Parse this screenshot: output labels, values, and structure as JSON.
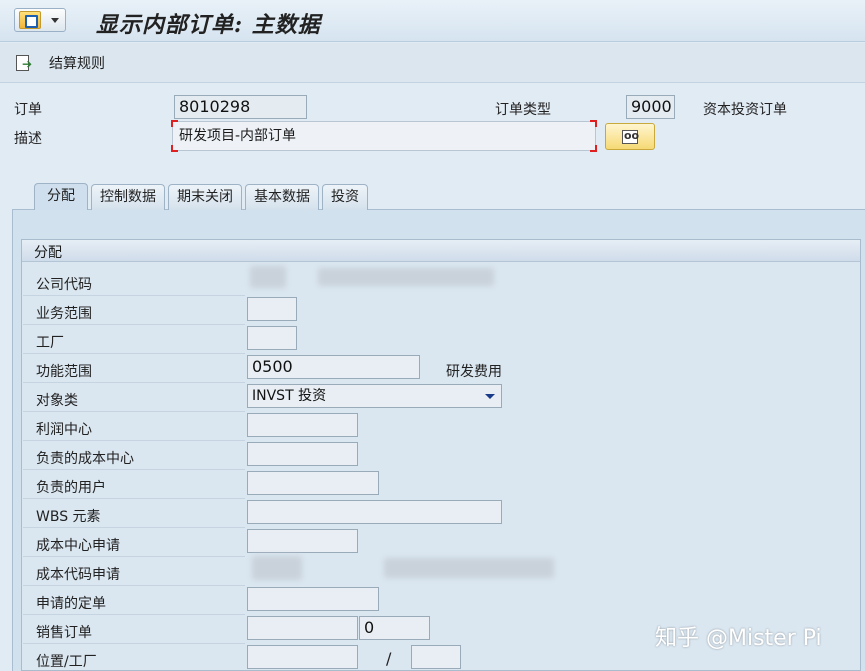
{
  "window": {
    "title": "显示内部订单: 主数据"
  },
  "toolbar": {
    "settlement_rule_label": "结算规则"
  },
  "header": {
    "order_label": "订单",
    "order_value": "8010298",
    "order_type_label": "订单类型",
    "order_type_value": "9000",
    "order_type_desc": "资本投资订单",
    "description_label": "描述",
    "description_value": "研发项目-内部订单"
  },
  "tabs": [
    {
      "label": "分配",
      "active": true
    },
    {
      "label": "控制数据"
    },
    {
      "label": "期末关闭"
    },
    {
      "label": "基本数据"
    },
    {
      "label": "投资"
    }
  ],
  "assignment": {
    "group_title": "分配",
    "company_code": {
      "label": "公司代码",
      "value": ""
    },
    "business_area": {
      "label": "业务范围",
      "value": ""
    },
    "plant": {
      "label": "工厂",
      "value": ""
    },
    "functional_area": {
      "label": "功能范围",
      "value": "0500",
      "desc": "研发费用"
    },
    "object_class": {
      "label": "对象类",
      "value": "INVST 投资"
    },
    "profit_center": {
      "label": "利润中心",
      "value": ""
    },
    "responsible_cost_center": {
      "label": "负责的成本中心",
      "value": ""
    },
    "responsible_user": {
      "label": "负责的用户",
      "value": ""
    },
    "wbs_element": {
      "label": "WBS 元素",
      "value": ""
    },
    "requesting_cost_center": {
      "label": "成本中心申请",
      "value": ""
    },
    "requesting_company_code": {
      "label": "成本代码申请",
      "value": ""
    },
    "requesting_order": {
      "label": "申请的定单",
      "value": ""
    },
    "sales_order": {
      "label": "销售订单",
      "value": "",
      "item": "0"
    },
    "location_plant": {
      "label": "位置/工厂",
      "separator": "/",
      "value": "",
      "plant": ""
    }
  },
  "watermark": "知乎 @Mister Pi",
  "colors": {
    "background": "#e1ebf4",
    "field_border": "#99aab9",
    "required_marker": "#e02020",
    "text_button": "#f6d974"
  }
}
